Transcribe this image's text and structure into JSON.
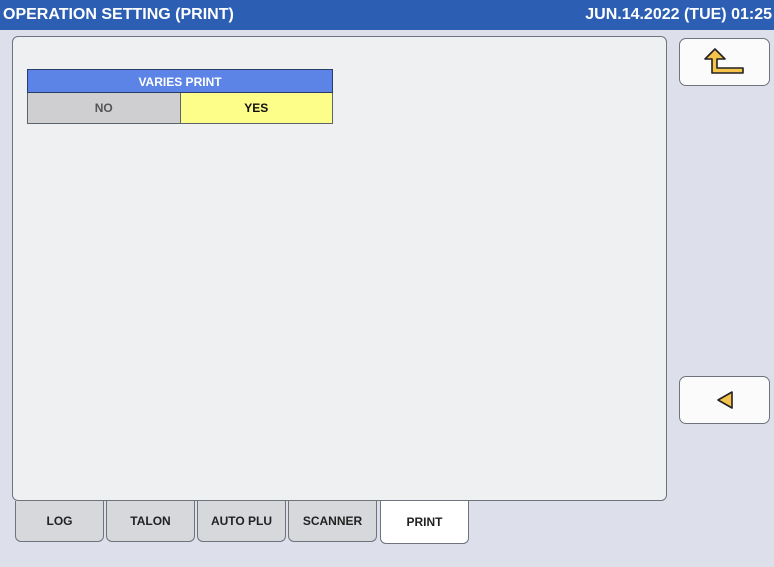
{
  "titlebar": {
    "title": "OPERATION SETTING (PRINT)",
    "datetime": "JUN.14.2022 (TUE)  01:25"
  },
  "setting": {
    "header": "VARIES PRINT",
    "options": [
      "NO",
      "YES"
    ],
    "selected": "YES"
  },
  "side_buttons": {
    "return_icon": "return-arrow-icon",
    "prev_icon": "left-triangle-icon"
  },
  "tabs": [
    {
      "label": "LOG"
    },
    {
      "label": "TALON"
    },
    {
      "label": "AUTO PLU"
    },
    {
      "label": "SCANNER"
    },
    {
      "label": "PRINT",
      "active": true
    }
  ],
  "colors": {
    "titlebar": "#2c5fb3",
    "setting_header": "#5b84e6",
    "selected_option": "#fdfd8a",
    "icon_fill": "#f5c24a"
  }
}
